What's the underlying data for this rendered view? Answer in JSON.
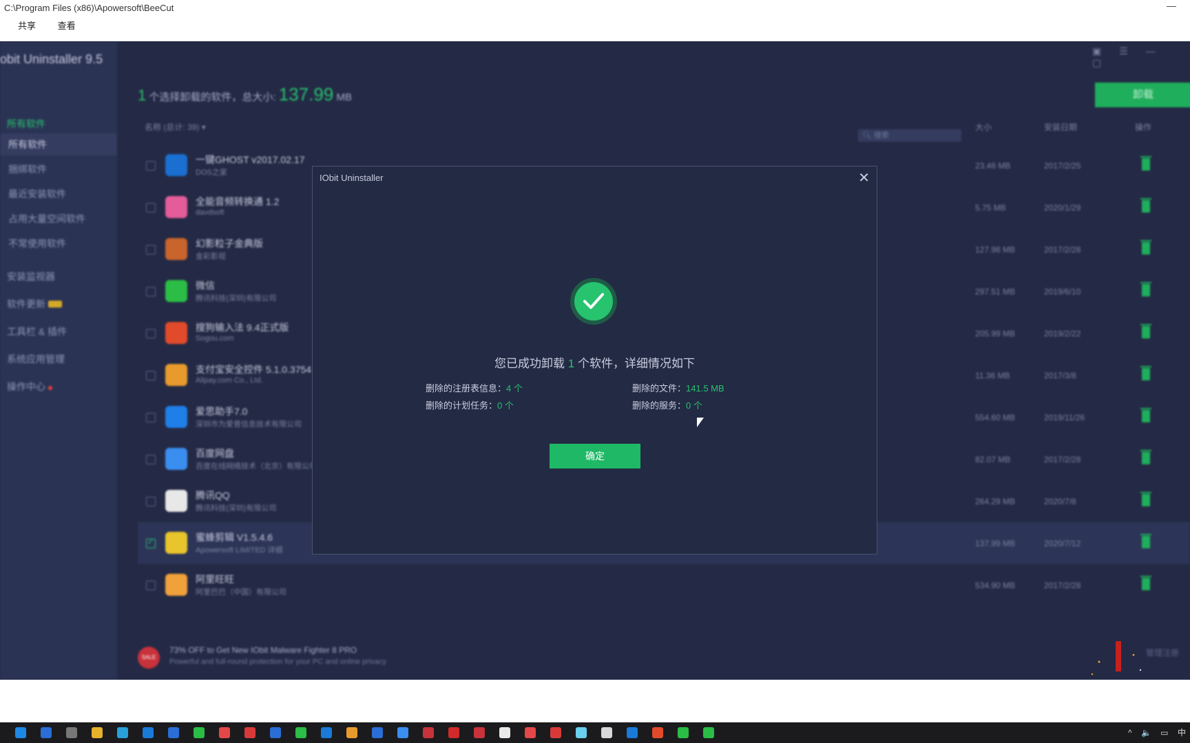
{
  "explorer": {
    "path": "C:\\Program Files (x86)\\Apowersoft\\BeeCut",
    "menu": [
      "共享",
      "查看"
    ]
  },
  "app": {
    "title": "obit Uninstaller 9.5",
    "sidebar": {
      "all_software": "所有软件",
      "sub_items": [
        "所有软件",
        "捆绑软件",
        "最近安装软件",
        "占用大量空间软件",
        "不常使用软件"
      ],
      "items": [
        "安装监视器",
        "软件更新",
        "工具栏 & 插件",
        "系统应用管理",
        "操作中心"
      ]
    },
    "summary": {
      "count": "1",
      "text": "个选择卸载的软件，总大小:",
      "size": "137.99",
      "unit": "MB"
    },
    "uninstall_label": "卸载",
    "list_header": {
      "name": "名称 (总计: 39)",
      "search_placeholder": "搜索",
      "size": "大小",
      "date": "安装日期",
      "action": "操作"
    },
    "rows": [
      {
        "name": "一键GHOST v2017.02.17",
        "publisher": "DOS之家",
        "size": "23.46 MB",
        "date": "2017/2/25",
        "color": "#1a6fd0",
        "checked": false
      },
      {
        "name": "全能音频转换通 1.2",
        "publisher": "davdsoft",
        "size": "5.75 MB",
        "date": "2020/1/29",
        "color": "#e45c9a",
        "checked": false
      },
      {
        "name": "幻影粒子金典版",
        "publisher": "金彩影视",
        "size": "127.98 MB",
        "date": "2017/2/28",
        "color": "#c8642c",
        "checked": false
      },
      {
        "name": "微信",
        "publisher": "腾讯科技(深圳)有限公司",
        "size": "297.51 MB",
        "date": "2019/6/10",
        "color": "#2bbd45",
        "checked": false
      },
      {
        "name": "搜狗输入法 9.4正式版",
        "publisher": "Sogou.com",
        "size": "205.99 MB",
        "date": "2019/2/22",
        "color": "#e24a2c",
        "checked": false
      },
      {
        "name": "支付宝安全控件 5.1.0.3754",
        "publisher": "Alipay.com Co., Ltd.",
        "size": "11.36 MB",
        "date": "2017/3/8",
        "color": "#e89b2c",
        "checked": false
      },
      {
        "name": "爱思助手7.0",
        "publisher": "深圳市为爱普信息技术有限公司",
        "size": "554.60 MB",
        "date": "2019/11/26",
        "color": "#1f7ee8",
        "checked": false
      },
      {
        "name": "百度网盘",
        "publisher": "百度在线网络技术（北京）有限公司",
        "size": "82.07 MB",
        "date": "2017/2/28",
        "color": "#3a8ef0",
        "checked": false
      },
      {
        "name": "腾讯QQ",
        "publisher": "腾讯科技(深圳)有限公司",
        "size": "264.29 MB",
        "date": "2020/7/8",
        "color": "#e8e8e8",
        "checked": false
      },
      {
        "name": "蜜蜂剪辑 V1.5.4.6",
        "publisher": "Apowersoft LIMITED",
        "publisher_extra": "详细",
        "size": "137.99 MB",
        "date": "2020/7/12",
        "color": "#e8c52c",
        "checked": true
      },
      {
        "name": "阿里旺旺",
        "publisher": "阿里巴巴（中国）有限公司",
        "size": "534.90 MB",
        "date": "2017/2/28",
        "color": "#f0a13a",
        "checked": false
      }
    ],
    "promo": {
      "title": "73% OFF to Get New IObit Malware Fighter 8 PRO",
      "subtitle": "Powerful and full-round protection for your PC and online privacy",
      "badge": "SALE",
      "manage": "管理注册"
    }
  },
  "dialog": {
    "title": "IObit Uninstaller",
    "close": "✕",
    "success_pre": "您已成功卸载",
    "success_count": "1",
    "success_post": "个软件，详细情况如下",
    "registry_label": "删除的注册表信息：",
    "registry_value": "4 个",
    "files_label": "删除的文件：",
    "files_value": "141.5 MB",
    "tasks_label": "删除的计划任务：",
    "tasks_value": "0 个",
    "services_label": "删除的服务：",
    "services_value": "0 个",
    "ok_label": "确定"
  },
  "taskbar": {
    "icon_colors": [
      "#1e88e5",
      "#2a6ed6",
      "#777",
      "#e5b22c",
      "#2aa0d8",
      "#1a7ad8",
      "#2a6ed6",
      "#2bbd45",
      "#e54848",
      "#d83a3a",
      "#2a6ed6",
      "#2bbd45",
      "#1a7ad8",
      "#e89b2c",
      "#2a6ed6",
      "#3a8ef0",
      "#c8323a",
      "#d02a2a",
      "#c8323a",
      "#e8e8e8",
      "#e54848",
      "#d83a3a",
      "#6ad0ee",
      "#d8d8d8",
      "#1a7ad8",
      "#e24a2c",
      "#2bbd45",
      "#2bbd45"
    ],
    "tray": [
      "^",
      "🔈",
      "▭",
      "中"
    ]
  }
}
